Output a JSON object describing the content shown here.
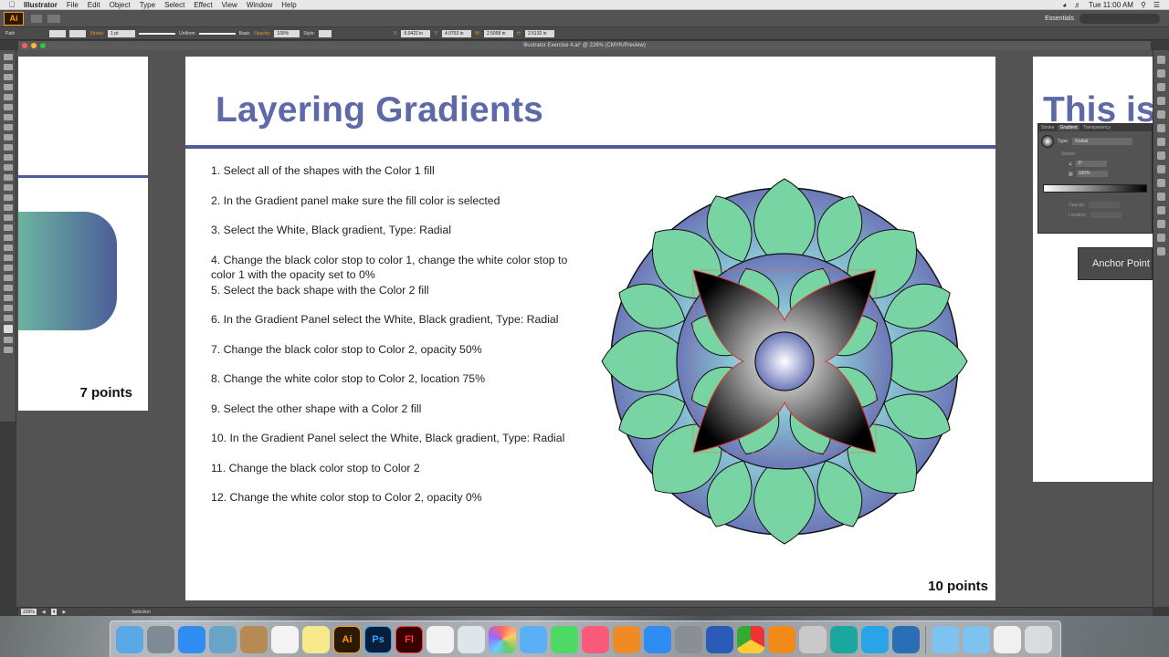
{
  "menubar": {
    "app_name": "Illustrator",
    "items": [
      "File",
      "Edit",
      "Object",
      "Type",
      "Select",
      "Effect",
      "View",
      "Window",
      "Help"
    ],
    "clock": "Tue 11:00 AM"
  },
  "appbar": {
    "logo": "Ai",
    "workspace": "Essentials"
  },
  "controlbar": {
    "selection_type": "Path",
    "stroke_label": "Stroke:",
    "stroke_weight": "1 pt",
    "profile": "Uniform",
    "brush": "Basic",
    "opacity_label": "Opacity:",
    "opacity": "100%",
    "style_label": "Style:",
    "x_label": "X:",
    "x": "6.0422 in",
    "y_label": "Y:",
    "y": "4.0753 in",
    "w_label": "W:",
    "w": "2.5058 in",
    "h_label": "H:",
    "h": "2.5132 in"
  },
  "document": {
    "title": "Illustrator Exercise 4.ai* @ 226% (CMYK/Preview)"
  },
  "artboards": {
    "left": {
      "points": "7 points"
    },
    "main": {
      "title": "Layering Gradients",
      "steps": [
        "1. Select all of the shapes with the Color 1 fill",
        "2. In the Gradient panel make sure the fill color is selected",
        "3. Select the White, Black gradient, Type: Radial",
        "4. Change the black color stop to color 1, change the white color stop to color 1 with the opacity set to 0%",
        "5. Select the back shape with the Color 2 fill",
        "6. In the Gradient Panel select the White, Black gradient, Type: Radial",
        "7. Change the black color stop to Color 2, opacity 50%",
        "8. Change the white color stop to Color 2, location 75%",
        "9. Select the other shape with a Color 2 fill",
        "10. In the Gradient Panel select the White, Black gradient, Type: Radial",
        "11. Change the black color stop to Color 2",
        "12. Change the white color stop to Color 2, opacity 0%"
      ],
      "points": "10 points"
    },
    "right": {
      "title": "This is"
    }
  },
  "gradient_panel": {
    "tabs": [
      "Stroke",
      "Gradient",
      "Transparency"
    ],
    "type_label": "Type:",
    "type_value": "Radial",
    "stroke_label": "Stroke:",
    "angle": "0°",
    "aspect": "100%",
    "opacity_label": "Opacity:",
    "location_label": "Location:"
  },
  "tooltip": {
    "text": "Anchor Point"
  },
  "statusbar": {
    "zoom": "226%",
    "artboard": "4",
    "tool": "Selection"
  },
  "colors": {
    "accent_blue": "#5e69a8",
    "rule_blue": "#4e5a95",
    "mint_green": "#79d4a4",
    "teal": "#8fd2d9",
    "periwinkle": "#6c78b8"
  }
}
